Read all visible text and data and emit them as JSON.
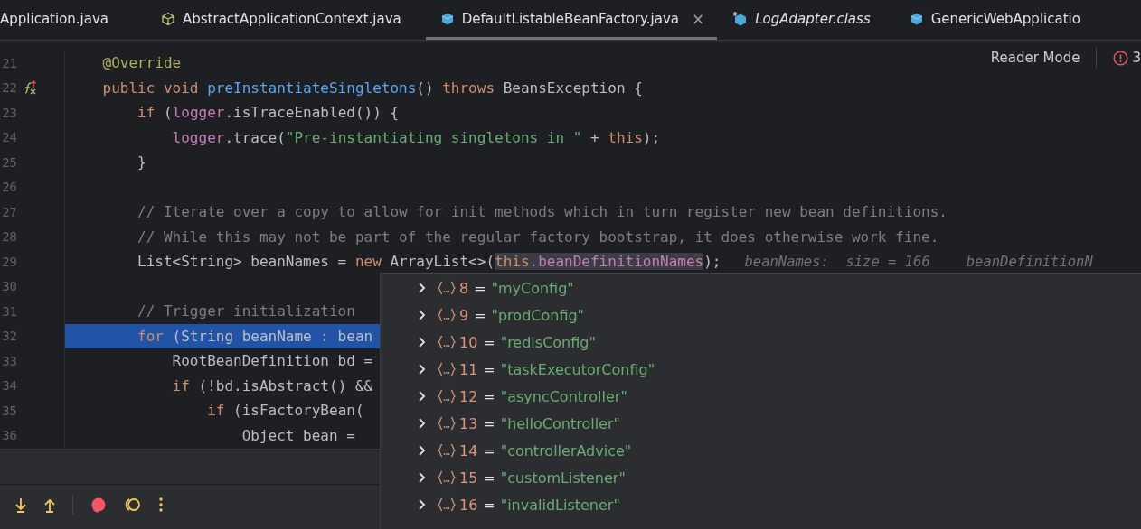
{
  "tabs": [
    {
      "label": "Application.java",
      "kind": "cut",
      "selected": false,
      "closable": false
    },
    {
      "label": "AbstractApplicationContext.java",
      "kind": "abstract",
      "selected": false,
      "closable": false
    },
    {
      "label": "DefaultListableBeanFactory.java",
      "kind": "class",
      "selected": true,
      "closable": true,
      "close_label": "×"
    },
    {
      "label": "LogAdapter.class",
      "kind": "compiled",
      "selected": false,
      "closable": false
    },
    {
      "label": "GenericWebApplicatio",
      "kind": "class",
      "selected": false,
      "closable": false
    }
  ],
  "editor": {
    "reader_mode": "Reader Mode",
    "error_count": "3",
    "lines": [
      {
        "number": "21",
        "current": false,
        "gutter_mark": false,
        "tokens": [
          {
            "kind": "annotation",
            "text": "    @Override"
          }
        ]
      },
      {
        "number": "22",
        "current": false,
        "gutter_mark": true,
        "tokens": [
          {
            "kind": "keyword",
            "text": "    public void "
          },
          {
            "kind": "decl",
            "text": "preInstantiateSingletons"
          },
          {
            "kind": "plain",
            "text": "() "
          },
          {
            "kind": "keyword",
            "text": "throws "
          },
          {
            "kind": "plain",
            "text": "BeansException {"
          }
        ]
      },
      {
        "number": "23",
        "current": false,
        "gutter_mark": false,
        "tokens": [
          {
            "kind": "keyword",
            "text": "        if "
          },
          {
            "kind": "plain",
            "text": "("
          },
          {
            "kind": "field",
            "text": "logger"
          },
          {
            "kind": "plain",
            "text": ".isTraceEnabled()) {"
          }
        ]
      },
      {
        "number": "24",
        "current": false,
        "gutter_mark": false,
        "tokens": [
          {
            "kind": "field",
            "text": "            logger"
          },
          {
            "kind": "plain",
            "text": ".trace("
          },
          {
            "kind": "string",
            "text": "\"Pre-instantiating singletons in \""
          },
          {
            "kind": "plain",
            "text": " + "
          },
          {
            "kind": "keyword",
            "text": "this"
          },
          {
            "kind": "plain",
            "text": ");"
          }
        ]
      },
      {
        "number": "25",
        "current": false,
        "gutter_mark": false,
        "tokens": [
          {
            "kind": "plain",
            "text": "        }"
          }
        ]
      },
      {
        "number": "26",
        "current": false,
        "gutter_mark": false
      },
      {
        "number": "27",
        "current": false,
        "gutter_mark": false,
        "tokens": [
          {
            "kind": "comment",
            "text": "        // Iterate over a copy to allow for init methods which in turn register new bean definitions."
          }
        ]
      },
      {
        "number": "28",
        "current": false,
        "gutter_mark": false,
        "tokens": [
          {
            "kind": "comment",
            "text": "        // While this may not be part of the regular factory bootstrap, it does otherwise work fine."
          }
        ]
      },
      {
        "number": "29",
        "current": false,
        "gutter_mark": false,
        "tokens": [
          {
            "kind": "plain",
            "text": "        List<String> beanNames = "
          },
          {
            "kind": "keyword",
            "text": "new "
          },
          {
            "kind": "plain",
            "text": "ArrayList<>("
          },
          {
            "kind": "hl-keyword",
            "text": "this"
          },
          {
            "kind": "hl-field",
            "text": ".beanDefinitionNames"
          },
          {
            "kind": "plain",
            "text": ");"
          }
        ],
        "hints": [
          "beanNames:  size = 166",
          "beanDefinitionN"
        ]
      },
      {
        "number": "30",
        "current": false,
        "gutter_mark": false
      },
      {
        "number": "31",
        "current": false,
        "gutter_mark": false,
        "tokens": [
          {
            "kind": "comment",
            "text": "        // Trigger initialization"
          }
        ]
      },
      {
        "number": "32",
        "current": true,
        "gutter_mark": false,
        "tokens": [
          {
            "kind": "keyword",
            "text": "        for "
          },
          {
            "kind": "plain",
            "text": "(String beanName : bean"
          }
        ]
      },
      {
        "number": "33",
        "current": false,
        "gutter_mark": false,
        "tokens": [
          {
            "kind": "plain",
            "text": "            RootBeanDefinition bd ="
          }
        ]
      },
      {
        "number": "34",
        "current": false,
        "gutter_mark": false,
        "tokens": [
          {
            "kind": "keyword",
            "text": "            if "
          },
          {
            "kind": "plain",
            "text": "(!bd.isAbstract() &&"
          }
        ]
      },
      {
        "number": "35",
        "current": false,
        "gutter_mark": false,
        "tokens": [
          {
            "kind": "keyword",
            "text": "                if "
          },
          {
            "kind": "plain",
            "text": "(isFactoryBean("
          }
        ]
      },
      {
        "number": "36",
        "current": false,
        "gutter_mark": false,
        "tokens": [
          {
            "kind": "plain",
            "text": "                    Object bean ="
          }
        ]
      }
    ]
  },
  "value_popup": {
    "items": [
      {
        "index": "8",
        "value": "\"myConfig\""
      },
      {
        "index": "9",
        "value": "\"prodConfig\""
      },
      {
        "index": "10",
        "value": "\"redisConfig\""
      },
      {
        "index": "11",
        "value": "\"taskExecutorConfig\""
      },
      {
        "index": "12",
        "value": "\"asyncController\""
      },
      {
        "index": "13",
        "value": "\"helloController\""
      },
      {
        "index": "14",
        "value": "\"controllerAdvice\""
      },
      {
        "index": "15",
        "value": "\"customListener\""
      },
      {
        "index": "16",
        "value": "\"invalidListener\""
      }
    ],
    "separator": "="
  }
}
